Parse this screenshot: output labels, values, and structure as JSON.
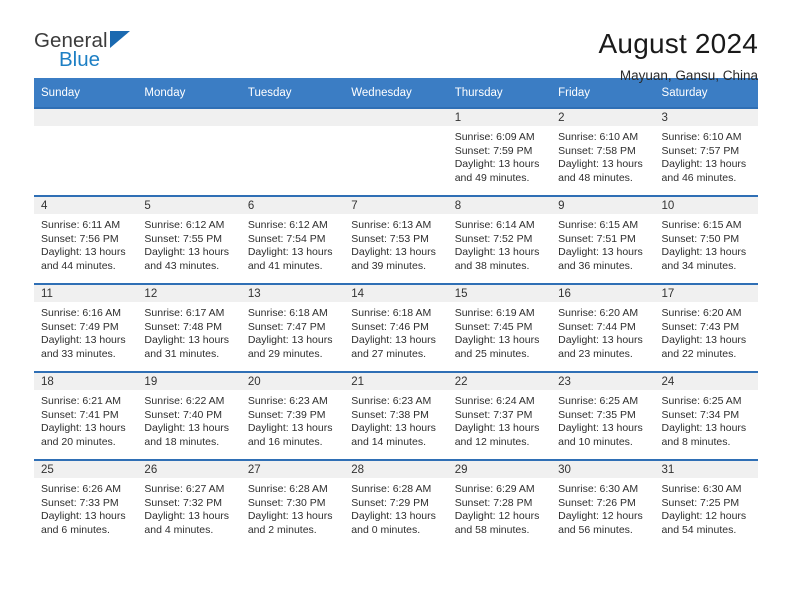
{
  "brand": {
    "name_line1": "General",
    "name_line2": "Blue",
    "accent_color": "#1d7fc4",
    "header_color": "#3b7dc4"
  },
  "header": {
    "title": "August 2024",
    "subtitle": "Mayuan, Gansu, China"
  },
  "calendar": {
    "weekday_headers": [
      "Sunday",
      "Monday",
      "Tuesday",
      "Wednesday",
      "Thursday",
      "Friday",
      "Saturday"
    ],
    "labels": {
      "sunrise": "Sunrise:",
      "sunset": "Sunset:",
      "daylight": "Daylight:"
    },
    "weeks": [
      [
        {
          "day": "",
          "empty": true
        },
        {
          "day": "",
          "empty": true
        },
        {
          "day": "",
          "empty": true
        },
        {
          "day": "",
          "empty": true
        },
        {
          "day": "1",
          "sunrise": "Sunrise: 6:09 AM",
          "sunset": "Sunset: 7:59 PM",
          "daylight1": "Daylight: 13 hours",
          "daylight2": "and 49 minutes."
        },
        {
          "day": "2",
          "sunrise": "Sunrise: 6:10 AM",
          "sunset": "Sunset: 7:58 PM",
          "daylight1": "Daylight: 13 hours",
          "daylight2": "and 48 minutes."
        },
        {
          "day": "3",
          "sunrise": "Sunrise: 6:10 AM",
          "sunset": "Sunset: 7:57 PM",
          "daylight1": "Daylight: 13 hours",
          "daylight2": "and 46 minutes."
        }
      ],
      [
        {
          "day": "4",
          "sunrise": "Sunrise: 6:11 AM",
          "sunset": "Sunset: 7:56 PM",
          "daylight1": "Daylight: 13 hours",
          "daylight2": "and 44 minutes."
        },
        {
          "day": "5",
          "sunrise": "Sunrise: 6:12 AM",
          "sunset": "Sunset: 7:55 PM",
          "daylight1": "Daylight: 13 hours",
          "daylight2": "and 43 minutes."
        },
        {
          "day": "6",
          "sunrise": "Sunrise: 6:12 AM",
          "sunset": "Sunset: 7:54 PM",
          "daylight1": "Daylight: 13 hours",
          "daylight2": "and 41 minutes."
        },
        {
          "day": "7",
          "sunrise": "Sunrise: 6:13 AM",
          "sunset": "Sunset: 7:53 PM",
          "daylight1": "Daylight: 13 hours",
          "daylight2": "and 39 minutes."
        },
        {
          "day": "8",
          "sunrise": "Sunrise: 6:14 AM",
          "sunset": "Sunset: 7:52 PM",
          "daylight1": "Daylight: 13 hours",
          "daylight2": "and 38 minutes."
        },
        {
          "day": "9",
          "sunrise": "Sunrise: 6:15 AM",
          "sunset": "Sunset: 7:51 PM",
          "daylight1": "Daylight: 13 hours",
          "daylight2": "and 36 minutes."
        },
        {
          "day": "10",
          "sunrise": "Sunrise: 6:15 AM",
          "sunset": "Sunset: 7:50 PM",
          "daylight1": "Daylight: 13 hours",
          "daylight2": "and 34 minutes."
        }
      ],
      [
        {
          "day": "11",
          "sunrise": "Sunrise: 6:16 AM",
          "sunset": "Sunset: 7:49 PM",
          "daylight1": "Daylight: 13 hours",
          "daylight2": "and 33 minutes."
        },
        {
          "day": "12",
          "sunrise": "Sunrise: 6:17 AM",
          "sunset": "Sunset: 7:48 PM",
          "daylight1": "Daylight: 13 hours",
          "daylight2": "and 31 minutes."
        },
        {
          "day": "13",
          "sunrise": "Sunrise: 6:18 AM",
          "sunset": "Sunset: 7:47 PM",
          "daylight1": "Daylight: 13 hours",
          "daylight2": "and 29 minutes."
        },
        {
          "day": "14",
          "sunrise": "Sunrise: 6:18 AM",
          "sunset": "Sunset: 7:46 PM",
          "daylight1": "Daylight: 13 hours",
          "daylight2": "and 27 minutes."
        },
        {
          "day": "15",
          "sunrise": "Sunrise: 6:19 AM",
          "sunset": "Sunset: 7:45 PM",
          "daylight1": "Daylight: 13 hours",
          "daylight2": "and 25 minutes."
        },
        {
          "day": "16",
          "sunrise": "Sunrise: 6:20 AM",
          "sunset": "Sunset: 7:44 PM",
          "daylight1": "Daylight: 13 hours",
          "daylight2": "and 23 minutes."
        },
        {
          "day": "17",
          "sunrise": "Sunrise: 6:20 AM",
          "sunset": "Sunset: 7:43 PM",
          "daylight1": "Daylight: 13 hours",
          "daylight2": "and 22 minutes."
        }
      ],
      [
        {
          "day": "18",
          "sunrise": "Sunrise: 6:21 AM",
          "sunset": "Sunset: 7:41 PM",
          "daylight1": "Daylight: 13 hours",
          "daylight2": "and 20 minutes."
        },
        {
          "day": "19",
          "sunrise": "Sunrise: 6:22 AM",
          "sunset": "Sunset: 7:40 PM",
          "daylight1": "Daylight: 13 hours",
          "daylight2": "and 18 minutes."
        },
        {
          "day": "20",
          "sunrise": "Sunrise: 6:23 AM",
          "sunset": "Sunset: 7:39 PM",
          "daylight1": "Daylight: 13 hours",
          "daylight2": "and 16 minutes."
        },
        {
          "day": "21",
          "sunrise": "Sunrise: 6:23 AM",
          "sunset": "Sunset: 7:38 PM",
          "daylight1": "Daylight: 13 hours",
          "daylight2": "and 14 minutes."
        },
        {
          "day": "22",
          "sunrise": "Sunrise: 6:24 AM",
          "sunset": "Sunset: 7:37 PM",
          "daylight1": "Daylight: 13 hours",
          "daylight2": "and 12 minutes."
        },
        {
          "day": "23",
          "sunrise": "Sunrise: 6:25 AM",
          "sunset": "Sunset: 7:35 PM",
          "daylight1": "Daylight: 13 hours",
          "daylight2": "and 10 minutes."
        },
        {
          "day": "24",
          "sunrise": "Sunrise: 6:25 AM",
          "sunset": "Sunset: 7:34 PM",
          "daylight1": "Daylight: 13 hours",
          "daylight2": "and 8 minutes."
        }
      ],
      [
        {
          "day": "25",
          "sunrise": "Sunrise: 6:26 AM",
          "sunset": "Sunset: 7:33 PM",
          "daylight1": "Daylight: 13 hours",
          "daylight2": "and 6 minutes."
        },
        {
          "day": "26",
          "sunrise": "Sunrise: 6:27 AM",
          "sunset": "Sunset: 7:32 PM",
          "daylight1": "Daylight: 13 hours",
          "daylight2": "and 4 minutes."
        },
        {
          "day": "27",
          "sunrise": "Sunrise: 6:28 AM",
          "sunset": "Sunset: 7:30 PM",
          "daylight1": "Daylight: 13 hours",
          "daylight2": "and 2 minutes."
        },
        {
          "day": "28",
          "sunrise": "Sunrise: 6:28 AM",
          "sunset": "Sunset: 7:29 PM",
          "daylight1": "Daylight: 13 hours",
          "daylight2": "and 0 minutes."
        },
        {
          "day": "29",
          "sunrise": "Sunrise: 6:29 AM",
          "sunset": "Sunset: 7:28 PM",
          "daylight1": "Daylight: 12 hours",
          "daylight2": "and 58 minutes."
        },
        {
          "day": "30",
          "sunrise": "Sunrise: 6:30 AM",
          "sunset": "Sunset: 7:26 PM",
          "daylight1": "Daylight: 12 hours",
          "daylight2": "and 56 minutes."
        },
        {
          "day": "31",
          "sunrise": "Sunrise: 6:30 AM",
          "sunset": "Sunset: 7:25 PM",
          "daylight1": "Daylight: 12 hours",
          "daylight2": "and 54 minutes."
        }
      ]
    ]
  }
}
